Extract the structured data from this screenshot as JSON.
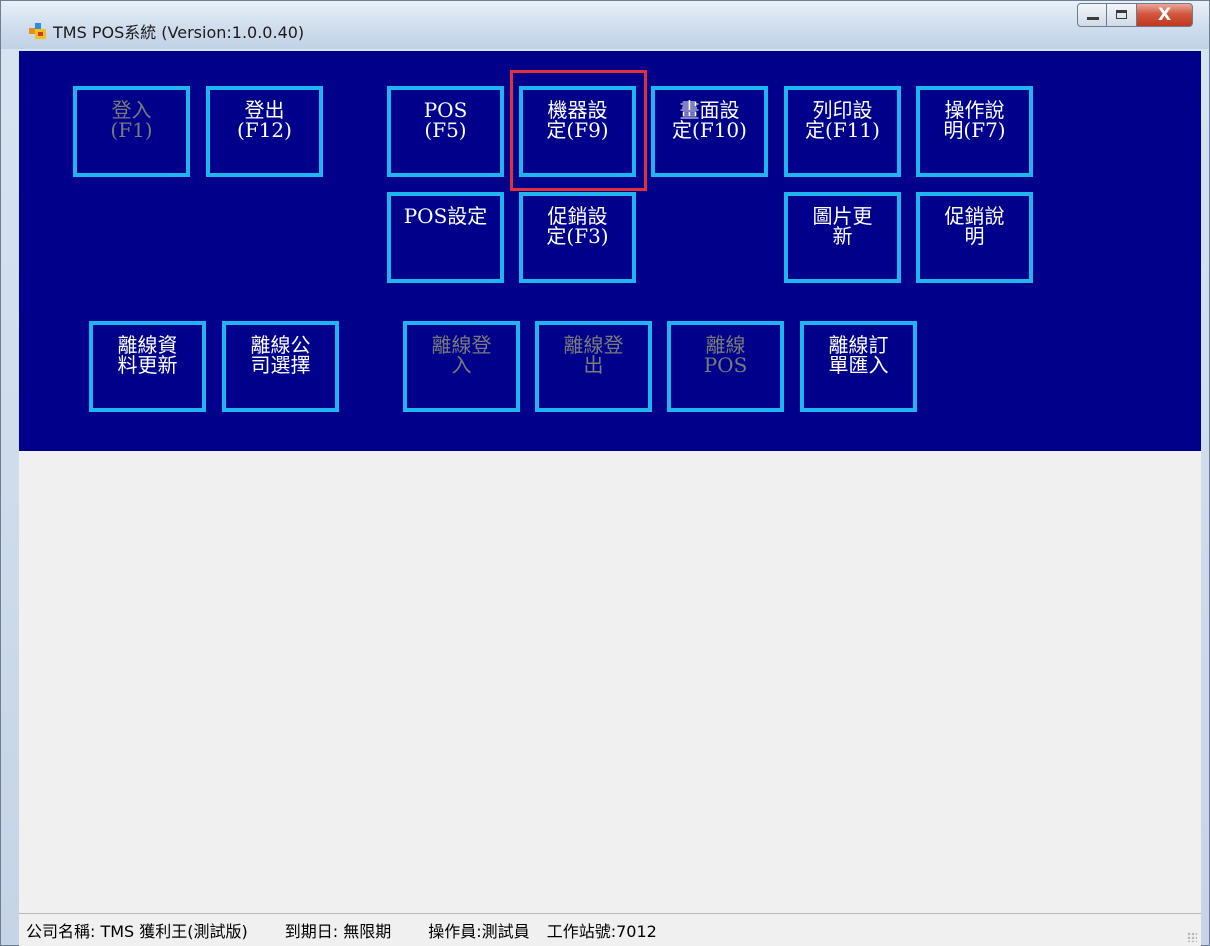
{
  "window": {
    "title": "TMS POS系統 (Version:1.0.0.40)",
    "close_glyph": "X"
  },
  "row1": [
    {
      "key": "login",
      "lines": [
        "登入",
        "(F1)"
      ],
      "enabled": false
    },
    {
      "key": "logout",
      "lines": [
        "登出",
        "(F12)"
      ],
      "enabled": true
    },
    {
      "key": "pos",
      "lines": [
        "POS",
        "(F5)"
      ],
      "enabled": true
    },
    {
      "key": "machine-settings",
      "lines": [
        "機器設",
        "定(F9)"
      ],
      "enabled": true,
      "selected": true
    },
    {
      "key": "screen-settings",
      "lines": [
        "畫面設",
        "定(F10)"
      ],
      "enabled": true
    },
    {
      "key": "print-settings",
      "lines": [
        "列印設",
        "定(F11)"
      ],
      "enabled": true
    },
    {
      "key": "operation-manual",
      "lines": [
        "操作說",
        "明(F7)"
      ],
      "enabled": true
    }
  ],
  "row2": [
    {
      "key": "pos-settings",
      "lines": [
        "POS設定"
      ],
      "enabled": true
    },
    {
      "key": "promotion-settings",
      "lines": [
        "促銷設",
        "定(F3)"
      ],
      "enabled": true
    },
    {
      "key": "image-update",
      "lines": [
        "圖片更",
        "新"
      ],
      "enabled": true
    },
    {
      "key": "promotion-info",
      "lines": [
        "促銷說",
        "明"
      ],
      "enabled": true
    }
  ],
  "row3": [
    {
      "key": "offline-data-update",
      "lines": [
        "離線資",
        "料更新"
      ],
      "enabled": true
    },
    {
      "key": "offline-company-select",
      "lines": [
        "離線公",
        "司選擇"
      ],
      "enabled": true
    },
    {
      "key": "offline-login",
      "lines": [
        "離線登",
        "入"
      ],
      "enabled": false
    },
    {
      "key": "offline-logout",
      "lines": [
        "離線登",
        "出"
      ],
      "enabled": false
    },
    {
      "key": "offline-pos",
      "lines": [
        "離線",
        "POS"
      ],
      "enabled": false
    },
    {
      "key": "offline-order-import",
      "lines": [
        "離線訂",
        "單匯入"
      ],
      "enabled": true
    }
  ],
  "status": {
    "company": "公司名稱: TMS 獲利王(測試版)",
    "expiry": "到期日: 無限期",
    "operator": "操作員:測試員",
    "station": "工作站號:7012"
  },
  "colors": {
    "panel_bg": "#00008b",
    "tile_border": "#1fb6f0",
    "text_enabled": "#ffffff",
    "text_disabled": "#7a7a7a",
    "highlight": "#e0303c"
  }
}
